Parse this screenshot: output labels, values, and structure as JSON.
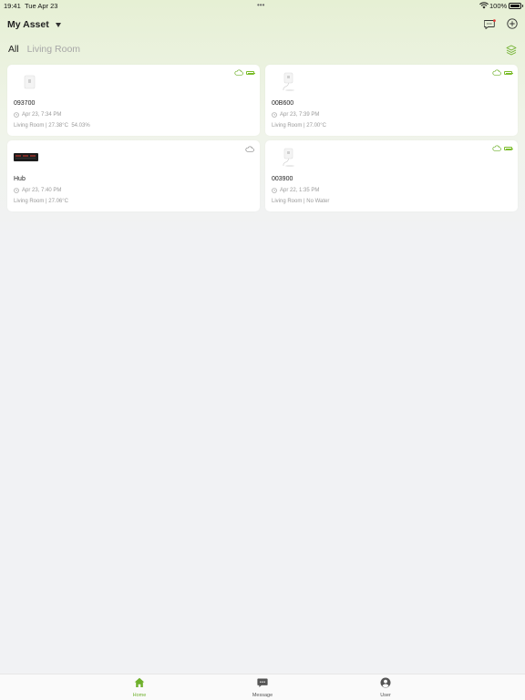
{
  "status_bar": {
    "time": "19:41",
    "date": "Tue Apr 23",
    "battery_pct": "100%"
  },
  "header": {
    "title": "My Asset",
    "message_icon": "message-icon",
    "add_icon": "add-icon"
  },
  "tabs": [
    {
      "label": "All",
      "active": true
    },
    {
      "label": "Living Room",
      "active": false
    }
  ],
  "devices": [
    {
      "name": "093700",
      "time": "Apr 23, 7:34 PM",
      "location": "Living Room | 27.38°C  54.03%",
      "image": "sensor-image",
      "battery": true
    },
    {
      "name": "00B600",
      "time": "Apr 23, 7:39 PM",
      "location": "Living Room | 27.00°C",
      "image": "probe-image",
      "battery": true
    },
    {
      "name": "Hub",
      "time": "Apr 23, 7:40 PM",
      "location": "Living Room | 27.06°C",
      "image": "hub-image",
      "battery": false
    },
    {
      "name": "003900",
      "time": "Apr 22, 1:35 PM",
      "location": "Living Room | No Water",
      "image": "probe-image",
      "battery": true
    }
  ],
  "tabbar": [
    {
      "label": "Home",
      "icon": "home-icon",
      "active": true
    },
    {
      "label": "Message",
      "icon": "message-icon",
      "active": false
    },
    {
      "label": "User",
      "icon": "user-icon",
      "active": false
    }
  ],
  "colors": {
    "accent": "#6eb02b",
    "muted_text": "#9a9a9a"
  }
}
